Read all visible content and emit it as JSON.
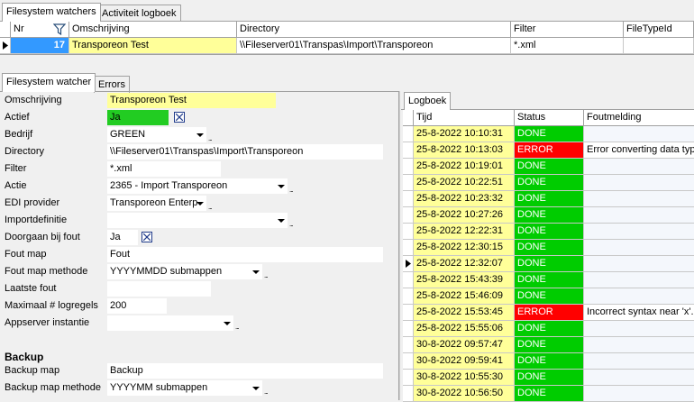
{
  "top_tabs": [
    "Filesystem watchers",
    "Activiteit logboek"
  ],
  "grid": {
    "columns": [
      "Nr",
      "Omschrijving",
      "Directory",
      "Filter",
      "FileTypeId"
    ],
    "row": {
      "nr": "17",
      "omschrijving": "Transporeon Test",
      "directory": "\\\\Fileserver01\\Transpas\\Import\\Transporeon",
      "filter": "*.xml",
      "filetypeid": ""
    }
  },
  "detail_tabs": [
    "Filesystem watcher",
    "Errors"
  ],
  "form": {
    "omschrijving": {
      "label": "Omschrijving",
      "value": "Transporeon Test"
    },
    "actief": {
      "label": "Actief",
      "value": "Ja"
    },
    "bedrijf": {
      "label": "Bedrijf",
      "value": "GREEN"
    },
    "directory": {
      "label": "Directory",
      "value": "\\\\Fileserver01\\Transpas\\Import\\Transporeon"
    },
    "filter": {
      "label": "Filter",
      "value": "*.xml"
    },
    "actie": {
      "label": "Actie",
      "value": "2365 - Import Transporeon"
    },
    "edi_provider": {
      "label": "EDI provider",
      "value": "Transporeon Enterp"
    },
    "importdefinitie": {
      "label": "Importdefinitie",
      "value": ""
    },
    "doorgaan": {
      "label": "Doorgaan bij fout",
      "value": "Ja"
    },
    "fout_map": {
      "label": "Fout map",
      "value": "Fout"
    },
    "fout_map_methode": {
      "label": "Fout map methode",
      "value": "YYYYMMDD submappen"
    },
    "laatste_fout": {
      "label": "Laatste fout",
      "value": ""
    },
    "max_logregels": {
      "label": "Maximaal # logregels",
      "value": "200"
    },
    "appserver": {
      "label": "Appserver instantie",
      "value": ""
    }
  },
  "backup": {
    "title": "Backup",
    "map": {
      "label": "Backup map",
      "value": "Backup"
    },
    "methode": {
      "label": "Backup map methode",
      "value": "YYYYMM submappen"
    }
  },
  "logboek": {
    "tab": "Logboek",
    "columns": [
      "Tijd",
      "Status",
      "Foutmelding"
    ],
    "rows": [
      {
        "tijd": "25-8-2022 10:10:31",
        "status": "DONE",
        "msg": ""
      },
      {
        "tijd": "25-8-2022 10:13:03",
        "status": "ERROR",
        "msg": "Error converting data type"
      },
      {
        "tijd": "25-8-2022 10:19:01",
        "status": "DONE",
        "msg": ""
      },
      {
        "tijd": "25-8-2022 10:22:51",
        "status": "DONE",
        "msg": ""
      },
      {
        "tijd": "25-8-2022 10:23:32",
        "status": "DONE",
        "msg": ""
      },
      {
        "tijd": "25-8-2022 10:27:26",
        "status": "DONE",
        "msg": ""
      },
      {
        "tijd": "25-8-2022 12:22:31",
        "status": "DONE",
        "msg": ""
      },
      {
        "tijd": "25-8-2022 12:30:15",
        "status": "DONE",
        "msg": ""
      },
      {
        "tijd": "25-8-2022 12:32:07",
        "status": "DONE",
        "msg": ""
      },
      {
        "tijd": "25-8-2022 15:43:39",
        "status": "DONE",
        "msg": ""
      },
      {
        "tijd": "25-8-2022 15:46:09",
        "status": "DONE",
        "msg": ""
      },
      {
        "tijd": "25-8-2022 15:53:45",
        "status": "ERROR",
        "msg": "Incorrect syntax near 'x'.In"
      },
      {
        "tijd": "25-8-2022 15:55:06",
        "status": "DONE",
        "msg": ""
      },
      {
        "tijd": "30-8-2022 09:57:47",
        "status": "DONE",
        "msg": ""
      },
      {
        "tijd": "30-8-2022 09:59:41",
        "status": "DONE",
        "msg": ""
      },
      {
        "tijd": "30-8-2022 10:55:30",
        "status": "DONE",
        "msg": ""
      },
      {
        "tijd": "30-8-2022 10:56:50",
        "status": "DONE",
        "msg": ""
      }
    ]
  },
  "colors": {
    "done": "#00cc00",
    "error": "#ff0000",
    "highlight": "#ffff99",
    "nr_cell": "#3399ff"
  },
  "icons": {
    "filter": "filter-icon",
    "row_pointer": "triangle-right-icon",
    "checkbox": "checkbox-icon"
  }
}
